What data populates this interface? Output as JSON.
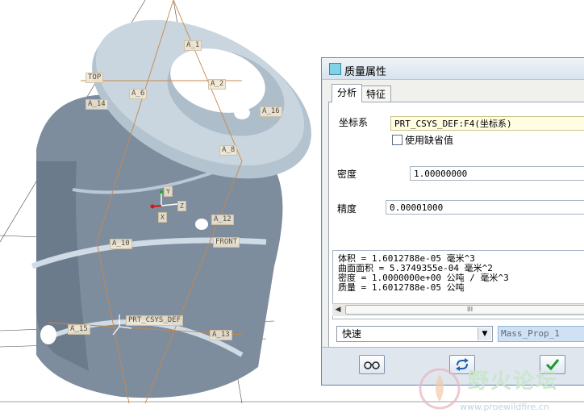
{
  "viewport": {
    "datum_labels": [
      "A_1",
      "A_2",
      "A_6",
      "A_14",
      "A_16",
      "A_8",
      "TOP",
      "A_12",
      "FRONT",
      "A_10",
      "PRT_CSYS_DEF",
      "A_15",
      "A_13"
    ],
    "axis_labels": {
      "x": "X",
      "y": "Y",
      "z": "Z"
    },
    "colors": {
      "part": "#8b9aab",
      "part_light": "#c4d2dd",
      "datum_line": "#c8884a"
    }
  },
  "dialog": {
    "title": "质量属性",
    "tabs": [
      "分析",
      "特征"
    ],
    "coord_label": "坐标系",
    "coord_value": "PRT_CSYS_DEF:F4(坐标系)",
    "default_checkbox_label": "使用缺省值",
    "density_label": "密度",
    "density_value": "1.00000000",
    "accuracy_label": "精度",
    "accuracy_value": "0.00001000",
    "results": [
      "体积 =  1.6012788e-05  毫米^3",
      "曲面面积 =  5.3749355e-04  毫米^2",
      "密度 =  1.0000000e+00 公吨 / 毫米^3",
      "质量 =  1.6012788e-05 公吨"
    ],
    "scrollbar_center": "III",
    "mode_value": "快速",
    "name_value": "Mass_Prop_1",
    "buttons": {
      "glasses": "preview-icon",
      "repeat": "repeat-icon",
      "ok": "check-icon"
    }
  },
  "watermark": {
    "text": "野火论坛",
    "url": "www.proewildfire.cn"
  }
}
